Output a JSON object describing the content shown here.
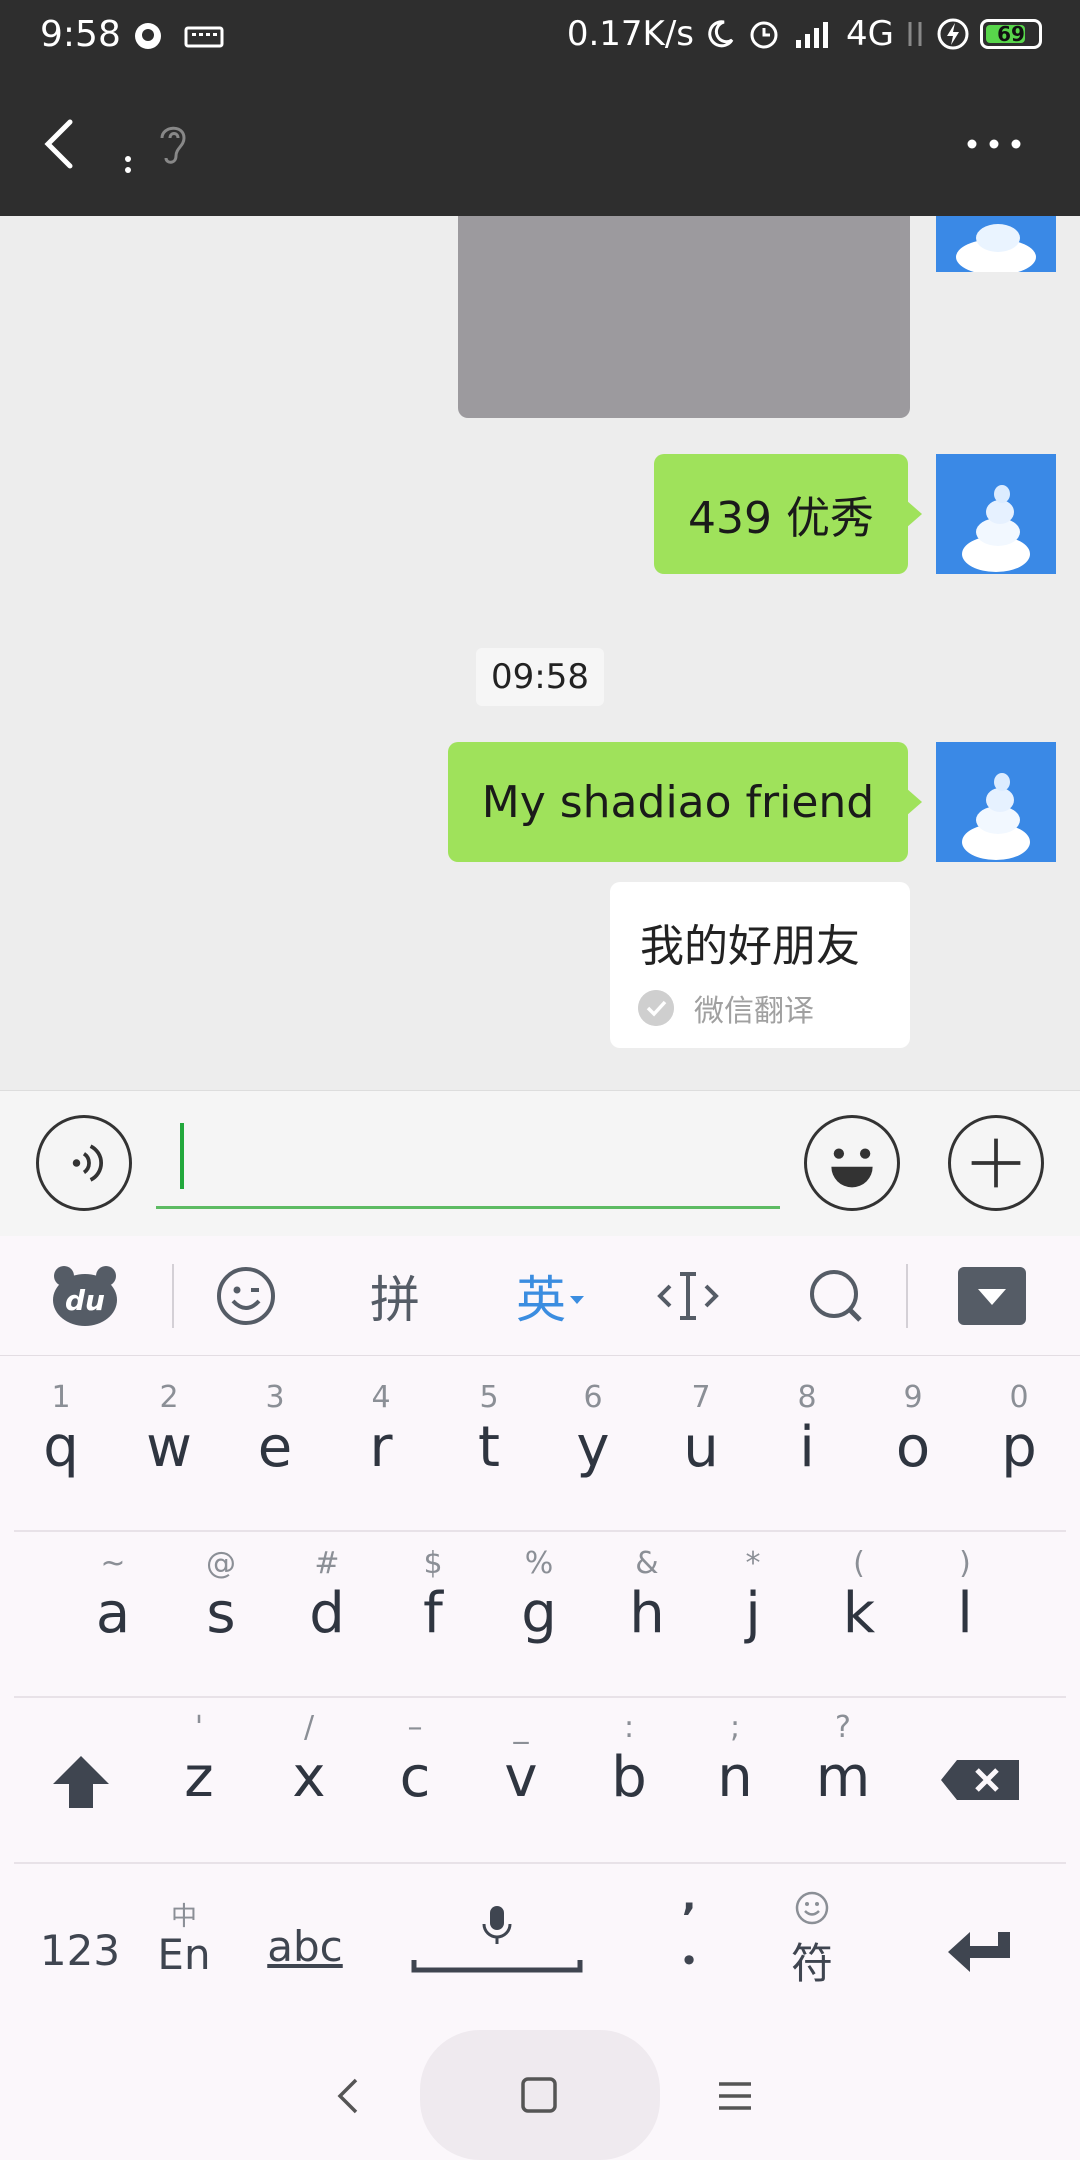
{
  "status_bar": {
    "time": "9:58",
    "network_speed": "0.17K/s",
    "network_type": "4G",
    "battery": "69"
  },
  "header": {
    "title": "་"
  },
  "chat": {
    "messages": [
      {
        "text": "439 优秀"
      },
      {
        "text": "My shadiao friend"
      }
    ],
    "timestamp": "09:58",
    "translation": {
      "text": "我的好朋友",
      "label": "微信翻译"
    }
  },
  "input": {
    "value": ""
  },
  "keyboard_toolbar": {
    "pinyin": "拼",
    "english": "英"
  },
  "keyboard": {
    "row1": [
      {
        "sub": "1",
        "main": "q"
      },
      {
        "sub": "2",
        "main": "w"
      },
      {
        "sub": "3",
        "main": "e"
      },
      {
        "sub": "4",
        "main": "r"
      },
      {
        "sub": "5",
        "main": "t"
      },
      {
        "sub": "6",
        "main": "y"
      },
      {
        "sub": "7",
        "main": "u"
      },
      {
        "sub": "8",
        "main": "i"
      },
      {
        "sub": "9",
        "main": "o"
      },
      {
        "sub": "0",
        "main": "p"
      }
    ],
    "row2": [
      {
        "sub": "~",
        "main": "a"
      },
      {
        "sub": "@",
        "main": "s"
      },
      {
        "sub": "#",
        "main": "d"
      },
      {
        "sub": "$",
        "main": "f"
      },
      {
        "sub": "%",
        "main": "g"
      },
      {
        "sub": "&",
        "main": "h"
      },
      {
        "sub": "*",
        "main": "j"
      },
      {
        "sub": "(",
        "main": "k"
      },
      {
        "sub": ")",
        "main": "l"
      }
    ],
    "row3": [
      {
        "sub": "'",
        "main": "z"
      },
      {
        "sub": "/",
        "main": "x"
      },
      {
        "sub": "–",
        "main": "c"
      },
      {
        "sub": "_",
        "main": "v"
      },
      {
        "sub": ":",
        "main": "b"
      },
      {
        "sub": ";",
        "main": "n"
      },
      {
        "sub": "?",
        "main": "m"
      }
    ],
    "num_key": "123",
    "lang_key_top": "中",
    "lang_key": "En",
    "abc_key": "abc",
    "punct_top": "’",
    "punct_main": "•",
    "symbol_key": "符"
  }
}
